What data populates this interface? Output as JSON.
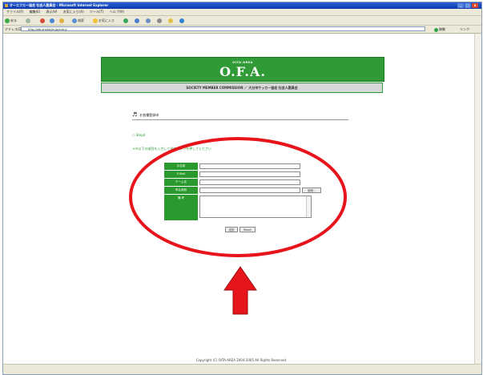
{
  "browser": {
    "title": "オーエフエー協会 社会人委員会 - Microsoft Internet Explorer",
    "menu": [
      "ファイル(F)",
      "編集(E)",
      "表示(V)",
      "お気に入り(A)",
      "ツール(T)",
      "ヘルプ(H)"
    ],
    "toolbar": {
      "back": "戻る",
      "search": "検索",
      "favorites": "お気に入り"
    },
    "address_label": "アドレス(D)",
    "address": "http://ofa-shakaijin.jp/entry/",
    "go_label": "移動",
    "links_label": "リンク"
  },
  "site": {
    "banner_small": "OITA-AREA",
    "banner_logo": "O.F.A.",
    "subtitle": "SOCIETY MEMBER COMMISSION ／ 大分市サッカー協会 社会人委員会"
  },
  "page": {
    "section_title": "お各種登録申",
    "step": "○ Step4",
    "note": "＊※以下の項目を入力して送信ボタンを押してください"
  },
  "form": {
    "fields": [
      {
        "label": "お名前"
      },
      {
        "label": "E-Mail"
      },
      {
        "label": "チーム名"
      },
      {
        "label": "申込用紙"
      },
      {
        "label": "備 考"
      }
    ],
    "browse_label": "参照...",
    "submit_label": "送信",
    "reset_label": "Reset"
  },
  "footer": {
    "copyright": "Copyright (C) OITA-AREA 2004-2005 All Rights Reserved."
  },
  "colors": {
    "brand_green": "#2f9a36",
    "annotation_red": "#e8141c"
  }
}
